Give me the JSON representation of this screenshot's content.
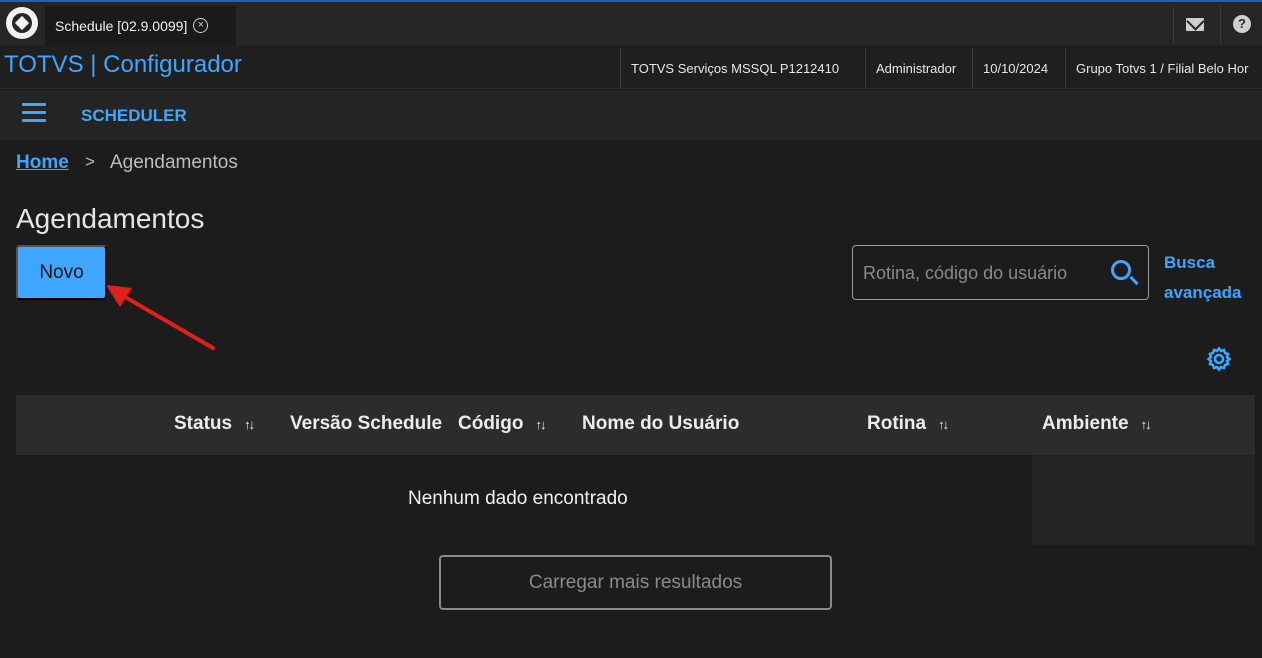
{
  "tabbar": {
    "tab_label": "Schedule [02.9.0099]",
    "close_symbol": "×"
  },
  "header": {
    "app_title": "TOTVS | Configurador",
    "environment": "TOTVS Serviços MSSQL P1212410",
    "user": "Administrador",
    "date": "10/10/2024",
    "branch": "Grupo Totvs 1 / Filial Belo Hor"
  },
  "menu": {
    "title": "SCHEDULER"
  },
  "breadcrumb": {
    "home": "Home",
    "separator": ">",
    "current": "Agendamentos"
  },
  "page": {
    "title": "Agendamentos",
    "new_button": "Novo"
  },
  "search": {
    "placeholder": "Rotina, código do usuário",
    "advanced_line1": "Busca",
    "advanced_line2": "avançada"
  },
  "table": {
    "columns": [
      {
        "label": "Status",
        "sortable": true
      },
      {
        "label": "Versão Schedule",
        "sortable": false
      },
      {
        "label": "Código",
        "sortable": true
      },
      {
        "label": "Nome do Usuário",
        "sortable": false
      },
      {
        "label": "Rotina",
        "sortable": true
      },
      {
        "label": "Ambiente",
        "sortable": true
      }
    ],
    "sort_symbol": "↑↓",
    "empty_message": "Nenhum dado encontrado",
    "load_more": "Carregar mais resultados"
  },
  "colors": {
    "accent": "#3ea6ff",
    "background": "#1c1c1c",
    "annotation_arrow": "#e0201b"
  }
}
